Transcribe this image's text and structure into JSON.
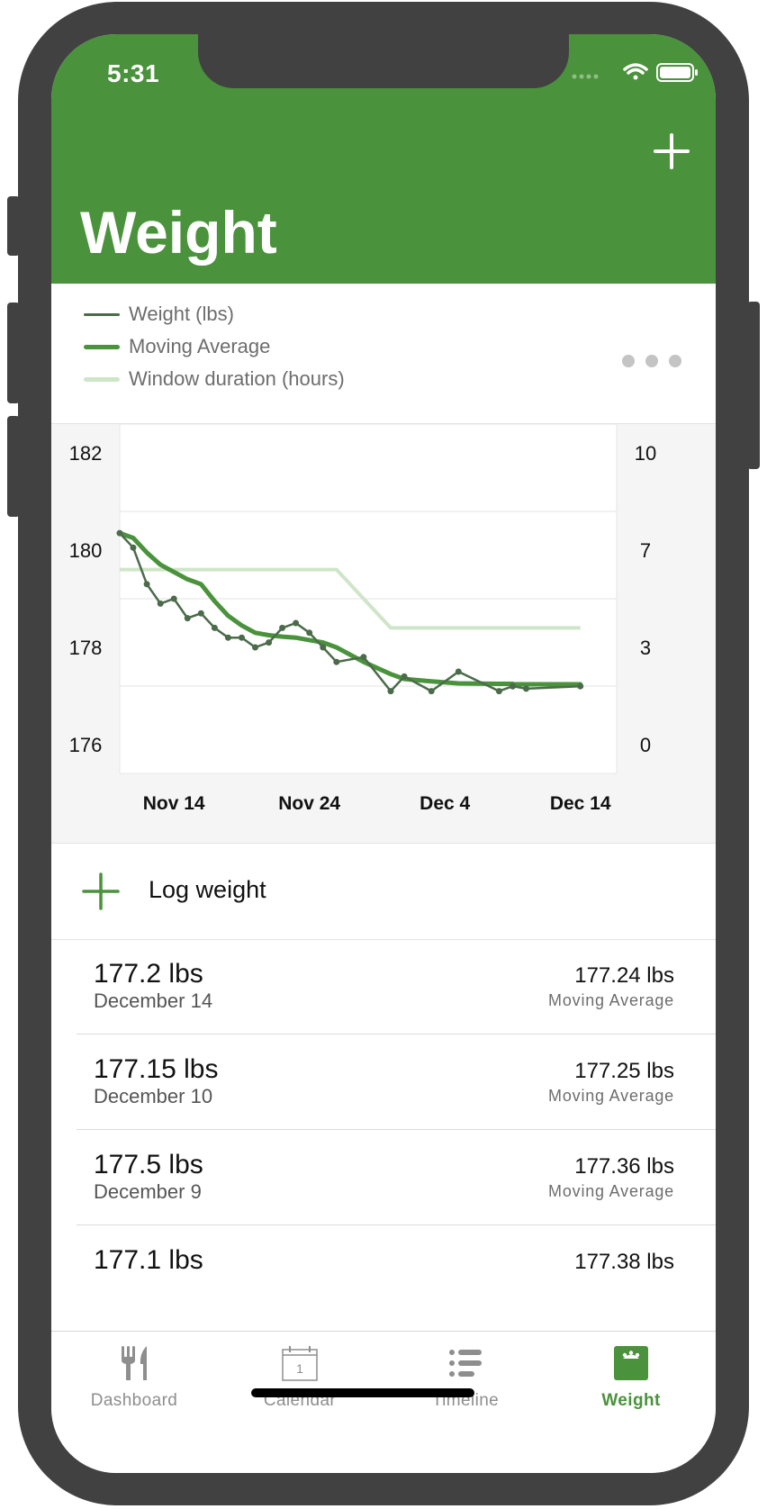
{
  "status_bar": {
    "time": "5:31",
    "icons": [
      "signal-icon",
      "wifi-icon",
      "battery-icon"
    ]
  },
  "header": {
    "title": "Weight",
    "add_icon": "plus-icon"
  },
  "legend": {
    "items": [
      {
        "label": "Weight (lbs)",
        "color": "#4b6b4a"
      },
      {
        "label": "Moving Average",
        "color": "#4a923c"
      },
      {
        "label": "Window duration (hours)",
        "color": "#cfe5c8"
      }
    ],
    "more_icon": "ellipsis-icon"
  },
  "chart_data": {
    "type": "line",
    "x": [
      "Nov 10",
      "Nov 11",
      "Nov 12",
      "Nov 13",
      "Nov 14",
      "Nov 15",
      "Nov 16",
      "Nov 17",
      "Nov 18",
      "Nov 19",
      "Nov 20",
      "Nov 21",
      "Nov 22",
      "Nov 23",
      "Nov 24",
      "Nov 25",
      "Nov 26",
      "Nov 28",
      "Nov 30",
      "Dec 1",
      "Dec 3",
      "Dec 5",
      "Dec 8",
      "Dec 9",
      "Dec 9",
      "Dec 10",
      "Dec 14"
    ],
    "x_ticks": [
      "Nov 14",
      "Nov 24",
      "Dec 4",
      "Dec 14"
    ],
    "y_left_ticks": [
      "182",
      "180",
      "178",
      "176"
    ],
    "y_right_ticks": [
      "10",
      "7",
      "3",
      "0"
    ],
    "ylim_left": [
      176,
      182
    ],
    "ylim_right": [
      0,
      10
    ],
    "series": [
      {
        "name": "Weight (lbs)",
        "axis": "left",
        "values": [
          180.35,
          180.05,
          179.3,
          178.9,
          179.0,
          178.6,
          178.7,
          178.4,
          178.2,
          178.2,
          178.0,
          178.1,
          178.4,
          178.5,
          178.3,
          178.0,
          177.7,
          177.8,
          177.1,
          177.4,
          177.1,
          177.5,
          177.1,
          177.2,
          177.2,
          177.15,
          177.2
        ]
      },
      {
        "name": "Moving Average",
        "axis": "left",
        "values": [
          180.35,
          180.25,
          179.95,
          179.7,
          179.55,
          179.4,
          179.3,
          178.95,
          178.65,
          178.45,
          178.3,
          178.25,
          178.22,
          178.2,
          178.15,
          178.1,
          178.0,
          177.7,
          177.45,
          177.35,
          177.3,
          177.26,
          177.25,
          177.25,
          177.24,
          177.24,
          177.24
        ]
      },
      {
        "name": "Window duration (hours)",
        "axis": "right",
        "values": [
          6,
          6,
          6,
          6,
          6,
          6,
          6,
          6,
          6,
          6,
          6,
          6,
          6,
          6,
          6,
          6,
          6,
          5,
          4,
          4,
          4,
          4,
          4,
          4,
          4,
          4,
          4
        ]
      }
    ],
    "grid": true
  },
  "log_weight": {
    "label": "Log weight",
    "icon": "plus-icon"
  },
  "entries": [
    {
      "weight": "177.2 lbs",
      "date": "December 14",
      "avg": "177.24 lbs",
      "avg_label": "Moving Average"
    },
    {
      "weight": "177.15 lbs",
      "date": "December 10",
      "avg": "177.25 lbs",
      "avg_label": "Moving Average"
    },
    {
      "weight": "177.5 lbs",
      "date": "December 9",
      "avg": "177.36 lbs",
      "avg_label": "Moving Average"
    },
    {
      "weight": "177.1 lbs",
      "date": "",
      "avg": "177.38 lbs",
      "avg_label": ""
    }
  ],
  "tabs": [
    {
      "label": "Dashboard",
      "icon": "fork-knife-icon"
    },
    {
      "label": "Calendar",
      "icon": "calendar-icon",
      "icon_text": "1"
    },
    {
      "label": "Timeline",
      "icon": "list-icon"
    },
    {
      "label": "Weight",
      "icon": "scale-icon",
      "active": true
    }
  ]
}
